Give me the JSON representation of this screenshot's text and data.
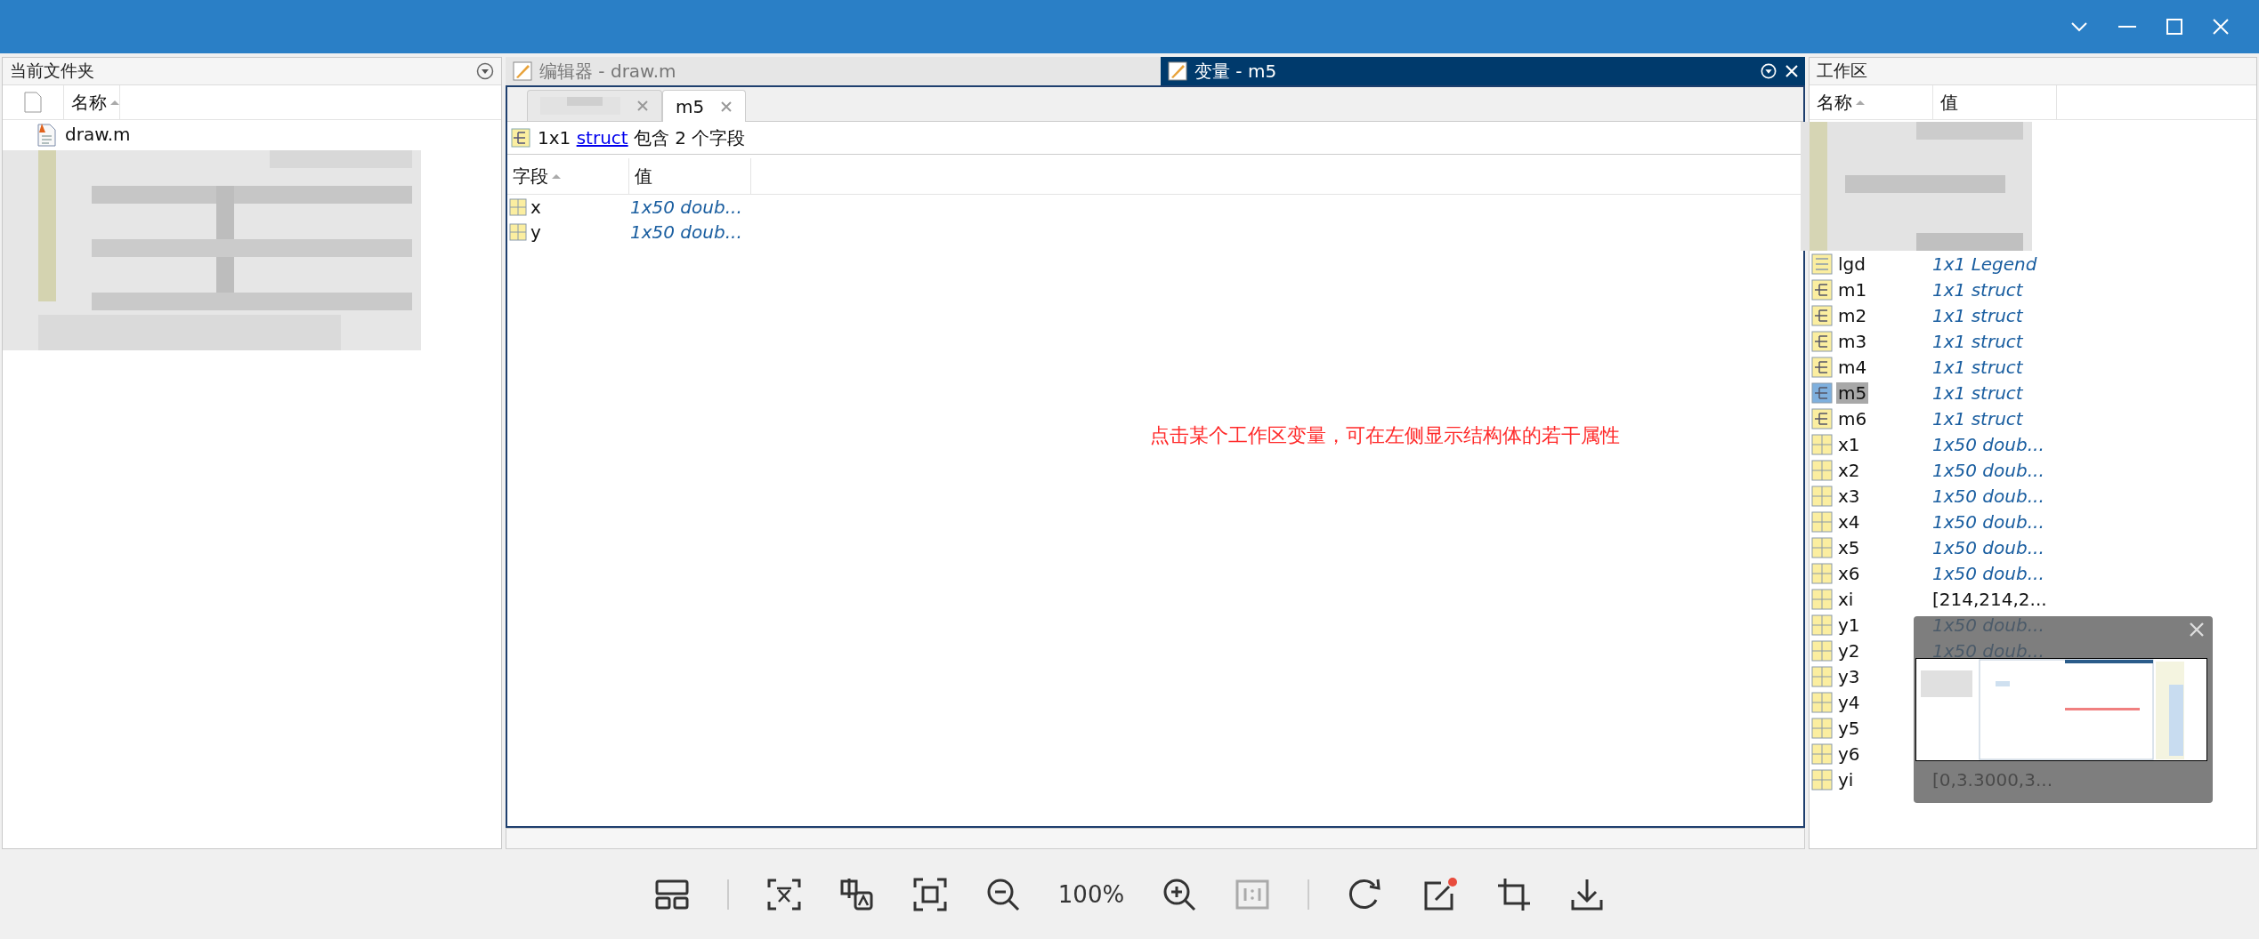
{
  "file_panel": {
    "title": "当前文件夹",
    "columns": [
      {
        "label": "名称",
        "sorted": true
      }
    ],
    "files": [
      {
        "name": "draw.m",
        "kind": "mfile"
      }
    ]
  },
  "editor": {
    "tabs": [
      {
        "label": "编辑器 - draw.m",
        "selected": false
      },
      {
        "label": "变量 - m5",
        "selected": true
      }
    ],
    "doc_tabs": [
      {
        "kind": "masked",
        "selected": false
      },
      {
        "kind": "text",
        "label": "m5",
        "selected": true
      }
    ],
    "summary": {
      "size": "1x1",
      "link": "struct",
      "text": "包含 2 个字段"
    },
    "columns": [
      {
        "label": "字段",
        "sorted": true
      },
      {
        "label": "值",
        "sorted": false
      }
    ],
    "rows": [
      {
        "name": "x",
        "value": "1x50 doub...",
        "kind": "matrix"
      },
      {
        "name": "y",
        "value": "1x50 doub...",
        "kind": "matrix"
      }
    ],
    "annotation": "点击某个工作区变量，可在左侧显示结构体的若干属性"
  },
  "workspace": {
    "title": "工作区",
    "columns": [
      {
        "label": "名称",
        "sorted": true
      },
      {
        "label": "值",
        "sorted": false
      }
    ],
    "variables": [
      {
        "name": "lgd",
        "value": "1x1 Legend",
        "kind": "object",
        "italic": true,
        "selected": false
      },
      {
        "name": "m1",
        "value": "1x1 struct",
        "kind": "struct",
        "italic": true,
        "selected": false
      },
      {
        "name": "m2",
        "value": "1x1 struct",
        "kind": "struct",
        "italic": true,
        "selected": false
      },
      {
        "name": "m3",
        "value": "1x1 struct",
        "kind": "struct",
        "italic": true,
        "selected": false
      },
      {
        "name": "m4",
        "value": "1x1 struct",
        "kind": "struct",
        "italic": true,
        "selected": false
      },
      {
        "name": "m5",
        "value": "1x1 struct",
        "kind": "struct",
        "italic": true,
        "selected": true
      },
      {
        "name": "m6",
        "value": "1x1 struct",
        "kind": "struct",
        "italic": true,
        "selected": false
      },
      {
        "name": "x1",
        "value": "1x50 doub...",
        "kind": "matrix",
        "italic": true,
        "selected": false
      },
      {
        "name": "x2",
        "value": "1x50 doub...",
        "kind": "matrix",
        "italic": true,
        "selected": false
      },
      {
        "name": "x3",
        "value": "1x50 doub...",
        "kind": "matrix",
        "italic": true,
        "selected": false
      },
      {
        "name": "x4",
        "value": "1x50 doub...",
        "kind": "matrix",
        "italic": true,
        "selected": false
      },
      {
        "name": "x5",
        "value": "1x50 doub...",
        "kind": "matrix",
        "italic": true,
        "selected": false
      },
      {
        "name": "x6",
        "value": "1x50 doub...",
        "kind": "matrix",
        "italic": true,
        "selected": false
      },
      {
        "name": "xi",
        "value": "[214,214,2...",
        "kind": "matrix",
        "italic": false,
        "selected": false
      },
      {
        "name": "y1",
        "value": "1x50 doub...",
        "kind": "matrix",
        "italic": true,
        "selected": false
      },
      {
        "name": "y2",
        "value": "1x50 doub...",
        "kind": "matrix",
        "italic": true,
        "selected": false
      },
      {
        "name": "y3",
        "kind": "matrix",
        "selected": false
      },
      {
        "name": "y4",
        "kind": "matrix",
        "selected": false
      },
      {
        "name": "y5",
        "kind": "matrix",
        "selected": false
      },
      {
        "name": "y6",
        "kind": "matrix",
        "selected": false
      },
      {
        "name": "yi",
        "value": "[0,3.3000,3...",
        "kind": "matrix",
        "italic": false,
        "selected": false
      }
    ]
  },
  "viewer": {
    "zoom": "100%"
  }
}
